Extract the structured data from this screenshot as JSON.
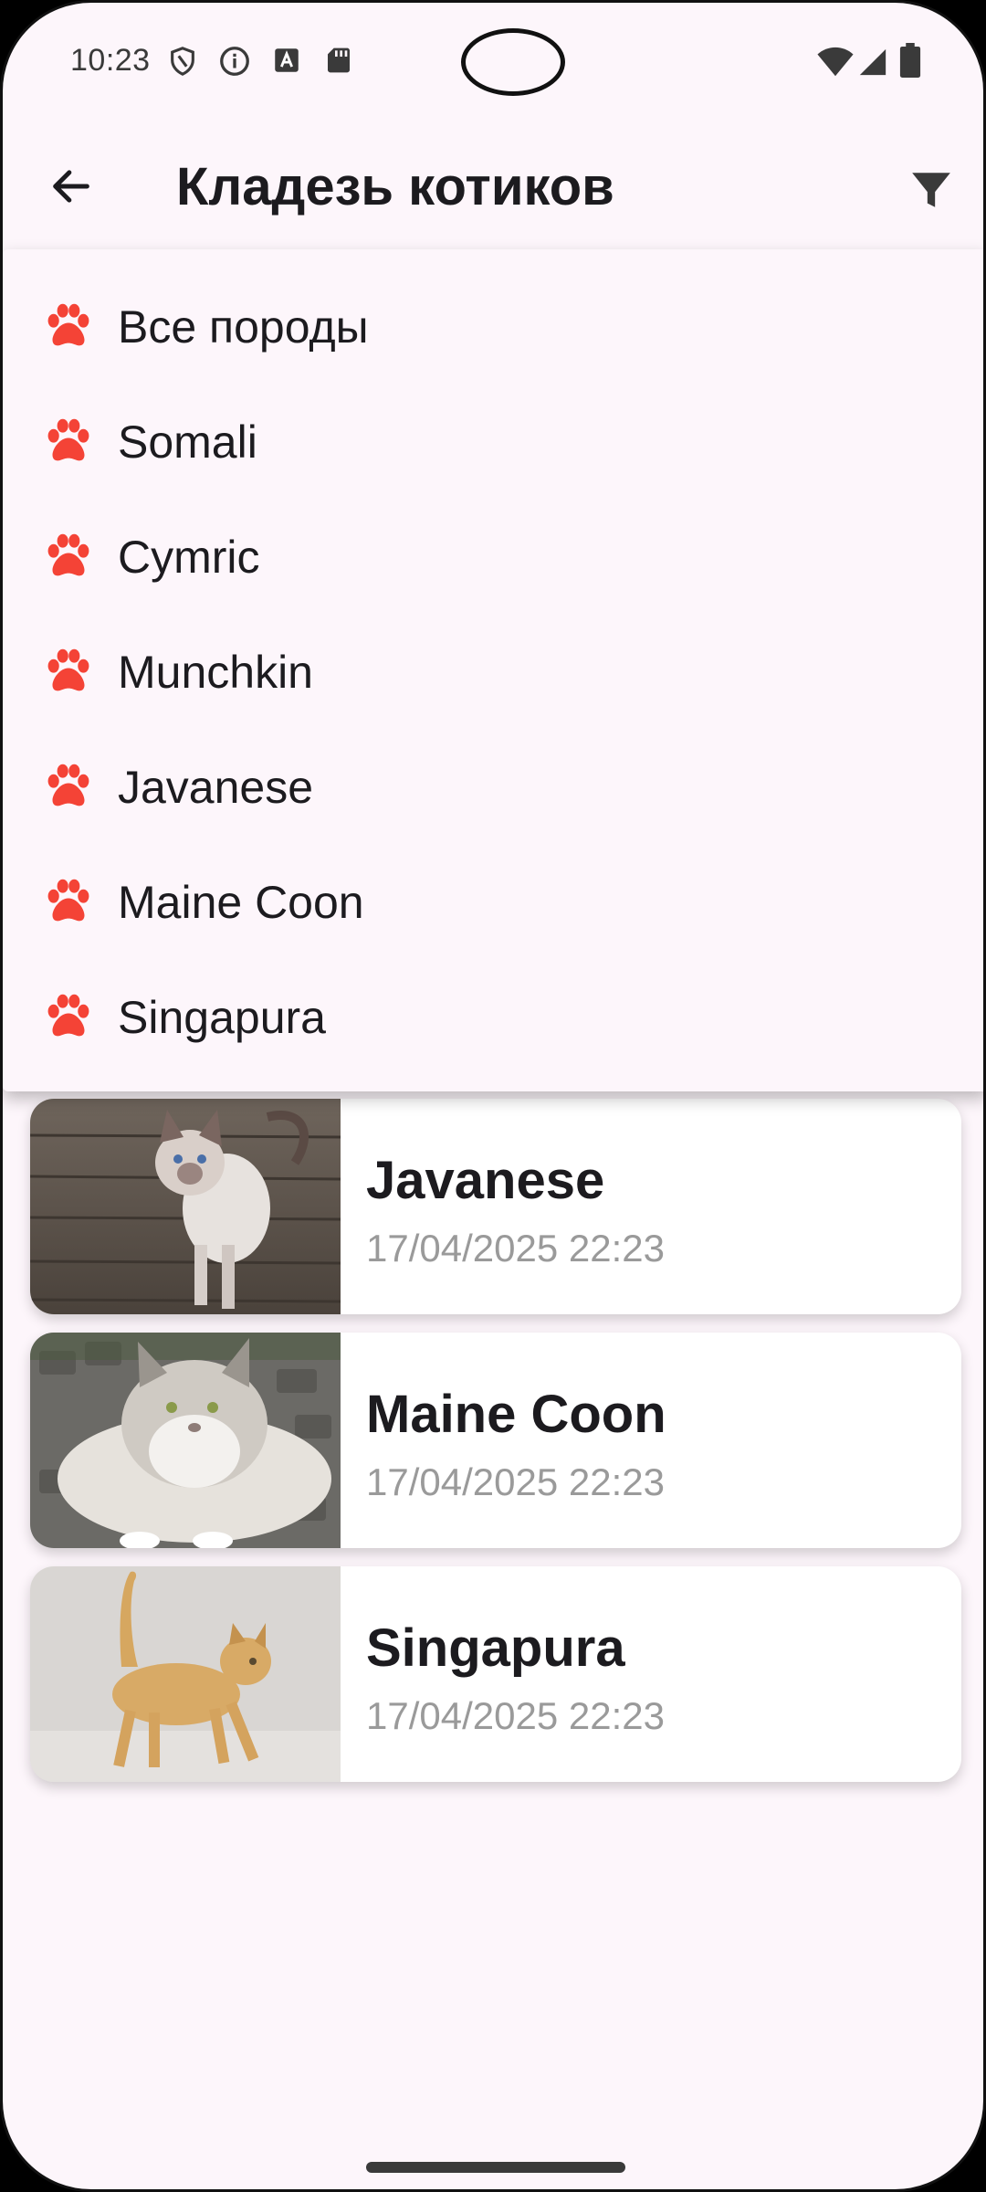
{
  "status_bar": {
    "time": "10:23",
    "icons_left": [
      "vpn-shield-icon",
      "info-icon",
      "font-icon",
      "sd-card-icon"
    ],
    "icons_right": [
      "wifi-icon",
      "cell-signal-icon",
      "battery-icon"
    ]
  },
  "app_bar": {
    "title": "Кладезь котиков",
    "back_icon": "arrow-back-icon",
    "filter_icon": "filter-icon"
  },
  "dropdown": {
    "icon": "paw-icon",
    "icon_color": "#f44336",
    "items": [
      {
        "label": "Все породы"
      },
      {
        "label": "Somali"
      },
      {
        "label": "Cymric"
      },
      {
        "label": "Munchkin"
      },
      {
        "label": "Javanese"
      },
      {
        "label": "Maine Coon"
      },
      {
        "label": "Singapura"
      }
    ]
  },
  "cards": [
    {
      "name": "Javanese",
      "date": "17/04/2025 22:23"
    },
    {
      "name": "Maine Coon",
      "date": "17/04/2025 22:23"
    },
    {
      "name": "Singapura",
      "date": "17/04/2025 22:23"
    }
  ],
  "colors": {
    "background": "#fdf6fb",
    "title_text": "#1c1b1f",
    "date_text": "#9a9a9a",
    "paw": "#f44336"
  }
}
